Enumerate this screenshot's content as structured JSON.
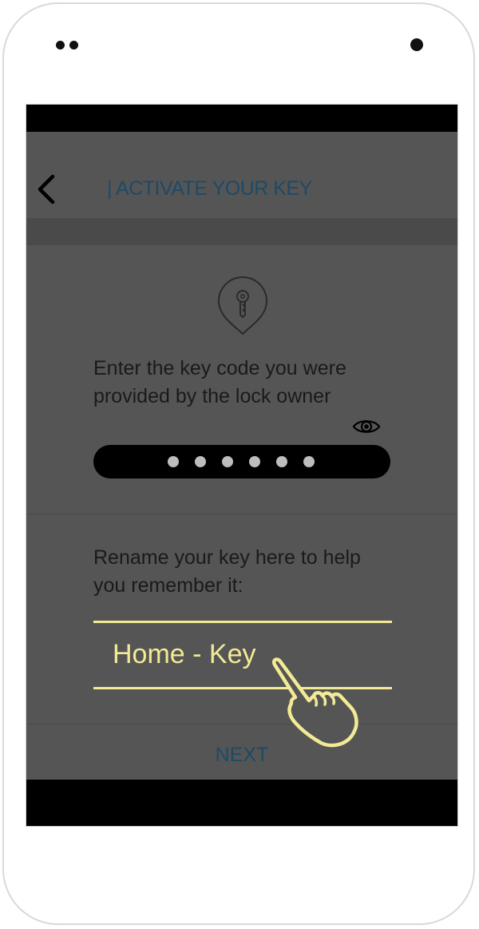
{
  "header": {
    "back_icon": "chevron-left-icon",
    "title": "| ACTIVATE YOUR KEY"
  },
  "key_section": {
    "icon": "key-pin-icon",
    "instruction": "Enter the key code you were provided by the lock owner",
    "toggle_icon": "eye-icon",
    "masked_dot_count": 6
  },
  "rename_section": {
    "label": "Rename your key here to help you remember it:",
    "value": "Home - Key",
    "gesture_icon": "pointing-hand-icon"
  },
  "footer": {
    "next_label": "NEXT"
  },
  "colors": {
    "screen_bg": "#555555",
    "title_blue": "#1e4a66",
    "highlight_yellow": "#f3ea95",
    "field_black": "#000000"
  }
}
